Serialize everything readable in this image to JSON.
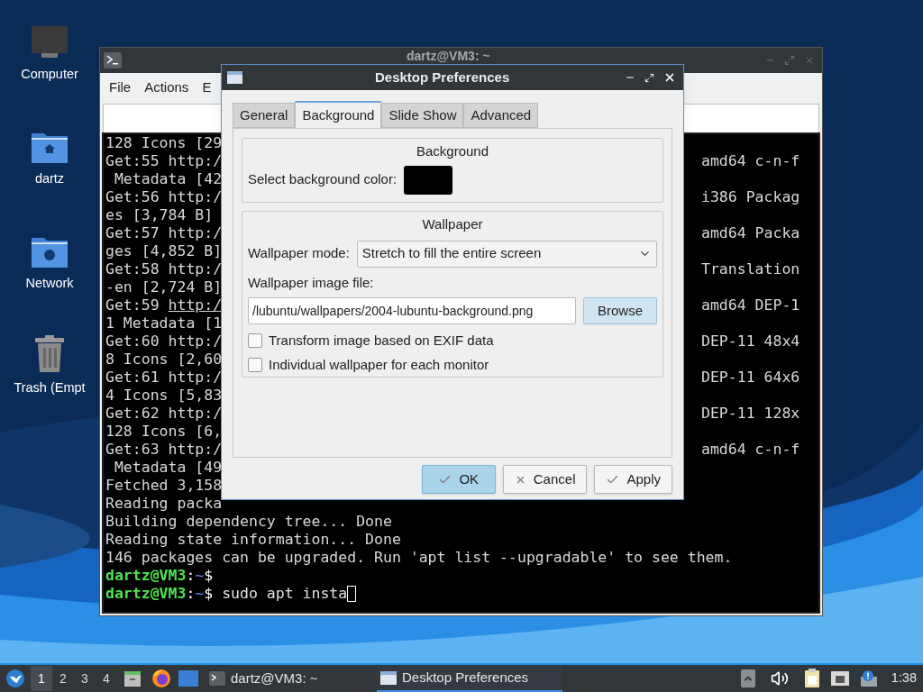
{
  "desktop_icons": [
    {
      "label": "Computer",
      "kind": "computer"
    },
    {
      "label": "dartz",
      "kind": "home"
    },
    {
      "label": "Network",
      "kind": "network"
    },
    {
      "label": "Trash (Empt",
      "kind": "trash"
    }
  ],
  "terminal": {
    "title": "dartz@VM3: ~",
    "menu": [
      "File",
      "Actions",
      "E"
    ],
    "lines": [
      {
        "kind": "split",
        "left": "128 Icons [29"
      },
      {
        "kind": "split",
        "left": "Get:55 http:/",
        "right": "amd64 c-n-f"
      },
      {
        "kind": "split",
        "left": " Metadata [42"
      },
      {
        "kind": "split",
        "left": "Get:56 http:/",
        "right": "i386 Packag"
      },
      {
        "kind": "split",
        "left": "es [3,784 B]"
      },
      {
        "kind": "split",
        "left": "Get:57 http:/",
        "right": "amd64 Packa"
      },
      {
        "kind": "split",
        "left": "ges [4,852 B]"
      },
      {
        "kind": "split",
        "left": "Get:58 http:/",
        "right": "Translation"
      },
      {
        "kind": "split",
        "left": "-en [2,724 B]"
      },
      {
        "kind": "split",
        "left": "Get:59 ",
        "link": "http:/",
        "right": "amd64 DEP-1"
      },
      {
        "kind": "split",
        "left": "1 Metadata [1"
      },
      {
        "kind": "split",
        "left": "Get:60 http:/",
        "right": "DEP-11 48x4"
      },
      {
        "kind": "split",
        "left": "8 Icons [2,60"
      },
      {
        "kind": "split",
        "left": "Get:61 http:/",
        "right": "DEP-11 64x6"
      },
      {
        "kind": "split",
        "left": "4 Icons [5,83"
      },
      {
        "kind": "split",
        "left": "Get:62 http:/",
        "right": "DEP-11 128x"
      },
      {
        "kind": "split",
        "left": "128 Icons [6,"
      },
      {
        "kind": "split",
        "left": "Get:63 http:/",
        "right": "amd64 c-n-f"
      },
      {
        "kind": "split",
        "left": " Metadata [49"
      },
      {
        "kind": "split",
        "left": "Fetched 3,158"
      },
      {
        "kind": "full",
        "text": "Reading packa"
      },
      {
        "kind": "full",
        "text": "Building dependency tree... Done"
      },
      {
        "kind": "full",
        "text": "Reading state information... Done"
      },
      {
        "kind": "full",
        "text": "146 packages can be upgraded. Run 'apt list --upgradable' to see them."
      },
      {
        "kind": "prompt",
        "user": "dartz@VM3",
        "sep": ":",
        "path": "~",
        "symbol": "$",
        "cursor": false
      },
      {
        "kind": "prompt",
        "user": "dartz@VM3",
        "sep": ":",
        "path": "~",
        "symbol": "$",
        "command": " sudo apt insta",
        "cursor": true
      }
    ]
  },
  "dialog": {
    "title": "Desktop Preferences",
    "tabs": [
      {
        "label": "General",
        "selected": false
      },
      {
        "label": "Background",
        "selected": true
      },
      {
        "label": "Slide Show",
        "selected": false
      },
      {
        "label": "Advanced",
        "selected": false
      }
    ],
    "background_group": {
      "title": "Background",
      "color_label": "Select background color:",
      "color": "#000000"
    },
    "wallpaper_group": {
      "title": "Wallpaper",
      "mode_label": "Wallpaper mode:",
      "mode_value": "Stretch to fill the entire screen",
      "file_label": "Wallpaper image file:",
      "file_value": "/lubuntu/wallpapers/2004-lubuntu-background.png",
      "browse": "Browse",
      "options": [
        {
          "label": "Transform image based on EXIF data",
          "checked": false
        },
        {
          "label": "Individual wallpaper for each monitor",
          "checked": false
        }
      ]
    },
    "buttons": [
      {
        "label": "OK",
        "kind": "ok",
        "default": true
      },
      {
        "label": "Cancel",
        "kind": "cancel",
        "default": false
      },
      {
        "label": "Apply",
        "kind": "apply",
        "default": false
      }
    ]
  },
  "taskbar": {
    "workspaces": [
      {
        "label": "1",
        "selected": true
      },
      {
        "label": "2",
        "selected": false
      },
      {
        "label": "3",
        "selected": false
      },
      {
        "label": "4",
        "selected": false
      }
    ],
    "tasks": [
      {
        "label": "dartz@VM3: ~",
        "kind": "terminal",
        "selected": false
      },
      {
        "label": "Desktop Preferences",
        "kind": "window",
        "selected": true
      }
    ],
    "clock": "1:38"
  }
}
